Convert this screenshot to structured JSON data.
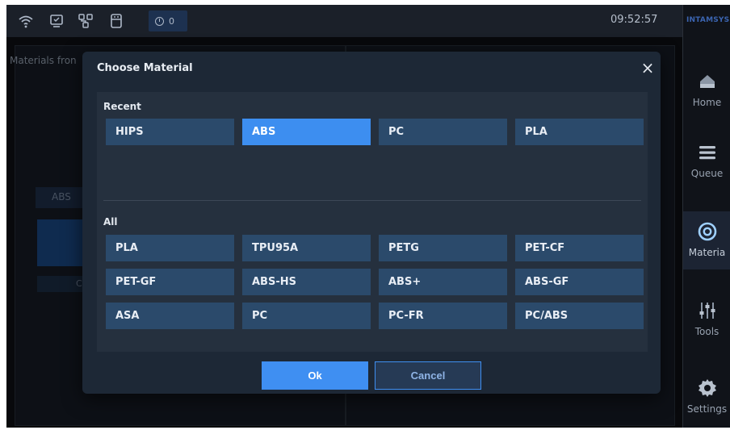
{
  "statusbar": {
    "alert_count": "0",
    "time": "09:52:57",
    "icons": [
      "wifi-icon",
      "screen-icon",
      "network-icon",
      "usb-icon",
      "alert-icon"
    ]
  },
  "sidebar": {
    "brand": "INTAMSYS",
    "items": [
      {
        "label": "Home",
        "icon": "home-icon"
      },
      {
        "label": "Queue",
        "icon": "queue-icon"
      },
      {
        "label": "Materia",
        "icon": "material-icon",
        "active": true
      },
      {
        "label": "Tools",
        "icon": "tools-icon"
      },
      {
        "label": "Settings",
        "icon": "settings-icon"
      }
    ]
  },
  "background": {
    "title": "Materials fron",
    "tag": "ABS",
    "strip_text": "C"
  },
  "modal": {
    "title": "Choose Material",
    "close_symbol": "×",
    "recent_label": "Recent",
    "recent": [
      "HIPS",
      "ABS",
      "PC",
      "PLA"
    ],
    "selected": "ABS",
    "all_label": "All",
    "all": [
      "PLA",
      "TPU95A",
      "PETG",
      "PET-CF",
      "PET-GF",
      "ABS-HS",
      "ABS+",
      "ABS-GF",
      "ASA",
      "PC",
      "PC-FR",
      "PC/ABS"
    ],
    "ok_label": "Ok",
    "cancel_label": "Cancel"
  },
  "colors": {
    "accent": "#3d8ef0",
    "tile": "#2b4a6b",
    "panel": "#1d2836"
  }
}
